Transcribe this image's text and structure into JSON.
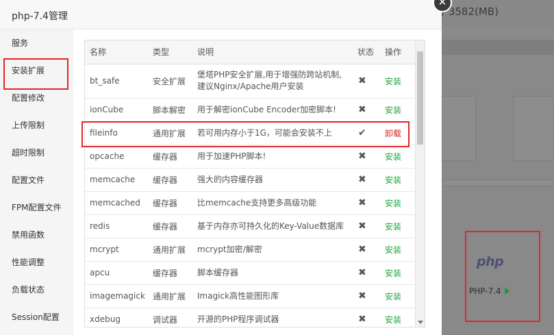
{
  "background": {
    "memory_text": "/ 3582(MB)",
    "php_logo": "php",
    "php_version": "PHP-7.4"
  },
  "dialog": {
    "title": "php-7.4管理",
    "close_icon": "✕"
  },
  "sidebar": {
    "items": [
      {
        "label": "服务"
      },
      {
        "label": "安装扩展"
      },
      {
        "label": "配置修改"
      },
      {
        "label": "上传限制"
      },
      {
        "label": "超时限制"
      },
      {
        "label": "配置文件"
      },
      {
        "label": "FPM配置文件"
      },
      {
        "label": "禁用函数"
      },
      {
        "label": "性能调整"
      },
      {
        "label": "负载状态"
      },
      {
        "label": "Session配置"
      }
    ],
    "active_index": 1
  },
  "table": {
    "headers": {
      "name": "名称",
      "type": "类型",
      "desc": "说明",
      "status": "状态",
      "action": "操作"
    },
    "rows": [
      {
        "name": "bt_safe",
        "type": "安全扩展",
        "desc": "堡塔PHP安全扩展,用于增强防跨站机制,建议Nginx/Apache用户安装",
        "status": "✖",
        "action": "安装"
      },
      {
        "name": "ionCube",
        "type": "脚本解密",
        "desc": "用于解密ionCube Encoder加密脚本!",
        "status": "✖",
        "action": "安装"
      },
      {
        "name": "fileinfo",
        "type": "通用扩展",
        "desc": "若可用内存小于1G，可能会安装不上",
        "status": "✔",
        "action": "卸载"
      },
      {
        "name": "opcache",
        "type": "缓存器",
        "desc": "用于加速PHP脚本!",
        "status": "✖",
        "action": "安装"
      },
      {
        "name": "memcache",
        "type": "缓存器",
        "desc": "强大的内容缓存器",
        "status": "✖",
        "action": "安装"
      },
      {
        "name": "memcached",
        "type": "缓存器",
        "desc": "比memcache支持更多高级功能",
        "status": "✖",
        "action": "安装"
      },
      {
        "name": "redis",
        "type": "缓存器",
        "desc": "基于内存亦可持久化的Key-Value数据库",
        "status": "✖",
        "action": "安装"
      },
      {
        "name": "mcrypt",
        "type": "通用扩展",
        "desc": "mcrypt加密/解密",
        "status": "✖",
        "action": "安装"
      },
      {
        "name": "apcu",
        "type": "缓存器",
        "desc": "脚本缓存器",
        "status": "✖",
        "action": "安装"
      },
      {
        "name": "imagemagick",
        "type": "通用扩展",
        "desc": "Imagick高性能图形库",
        "status": "✖",
        "action": "安装"
      },
      {
        "name": "xdebug",
        "type": "调试器",
        "desc": "开源的PHP程序调试器",
        "status": "✖",
        "action": "安装"
      }
    ]
  }
}
